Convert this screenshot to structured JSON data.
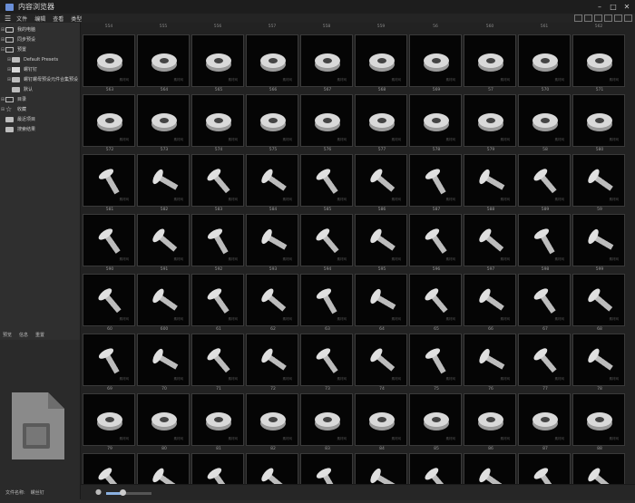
{
  "window": {
    "title": "内容浏览器"
  },
  "menu": [
    "文件",
    "编辑",
    "查看",
    "类型"
  ],
  "tree": [
    {
      "label": "我的电脑",
      "icon": "monitor",
      "indent": 0,
      "exp": "⊞"
    },
    {
      "label": "同步预设",
      "icon": "box",
      "indent": 0,
      "exp": "⊞"
    },
    {
      "label": "预置",
      "icon": "box",
      "indent": 0,
      "exp": "⊟"
    },
    {
      "label": "Default Presets",
      "icon": "folder",
      "indent": 1,
      "exp": "⊞"
    },
    {
      "label": "螺钉钉",
      "icon": "sel",
      "indent": 1,
      "exp": "⊞"
    },
    {
      "label": "螺钉螺母预设元件合集预设",
      "icon": "folder",
      "indent": 1,
      "exp": "⊞"
    },
    {
      "label": "默认",
      "icon": "folder",
      "indent": 1,
      "exp": ""
    },
    {
      "label": "目录",
      "icon": "box",
      "indent": 0,
      "exp": "⊞"
    },
    {
      "label": "收藏",
      "icon": "star",
      "indent": 0,
      "exp": "⊞"
    },
    {
      "label": "最近项目",
      "icon": "folder",
      "indent": 0,
      "exp": ""
    },
    {
      "label": "搜索结果",
      "icon": "folder",
      "indent": 0,
      "exp": ""
    }
  ],
  "preview_tabs": [
    "预览",
    "信息",
    "重置"
  ],
  "filename": {
    "label": "文件名称:",
    "value": "螺丝钉"
  },
  "top_labels": [
    "554",
    "555",
    "556",
    "557",
    "558",
    "559",
    "56",
    "560",
    "561",
    "562"
  ],
  "rows": [
    [
      "563",
      "564",
      "565",
      "566",
      "567",
      "568",
      "569",
      "57",
      "570",
      "571"
    ],
    [
      "572",
      "573",
      "574",
      "575",
      "576",
      "577",
      "578",
      "579",
      "58",
      "580"
    ],
    [
      "581",
      "582",
      "583",
      "584",
      "585",
      "586",
      "587",
      "588",
      "589",
      "59"
    ],
    [
      "590",
      "591",
      "592",
      "593",
      "594",
      "595",
      "596",
      "597",
      "598",
      "599"
    ],
    [
      "60",
      "600",
      "61",
      "62",
      "63",
      "64",
      "65",
      "66",
      "67",
      "68"
    ],
    [
      "69",
      "70",
      "71",
      "72",
      "73",
      "74",
      "75",
      "76",
      "77",
      "78"
    ],
    [
      "79",
      "80",
      "81",
      "82",
      "83",
      "84",
      "85",
      "86",
      "87",
      "88"
    ],
    [
      "",
      "",
      "",
      "",
      "",
      "",
      "",
      "",
      "",
      ""
    ]
  ],
  "watermark": "素材网",
  "zoom": {
    "level": 0.35
  },
  "colors": {
    "accent": "#8ab0e0",
    "background": "#222222"
  }
}
